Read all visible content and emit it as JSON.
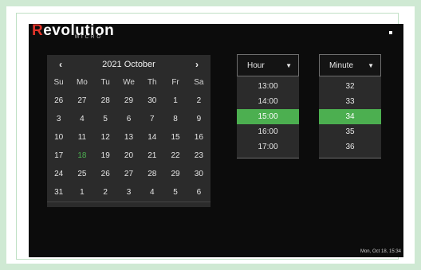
{
  "brand": {
    "logo_first": "R",
    "logo_rest": "evolution",
    "logo_sub": "MICRO"
  },
  "calendar": {
    "year": "2021",
    "month": "October",
    "prev_icon": "‹",
    "next_icon": "›",
    "weekdays": [
      "Su",
      "Mo",
      "Tu",
      "We",
      "Th",
      "Fr",
      "Sa"
    ],
    "weeks": [
      [
        "26",
        "27",
        "28",
        "29",
        "30",
        "1",
        "2"
      ],
      [
        "3",
        "4",
        "5",
        "6",
        "7",
        "8",
        "9"
      ],
      [
        "10",
        "11",
        "12",
        "13",
        "14",
        "15",
        "16"
      ],
      [
        "17",
        "18",
        "19",
        "20",
        "21",
        "22",
        "23"
      ],
      [
        "24",
        "25",
        "26",
        "27",
        "28",
        "29",
        "30"
      ],
      [
        "31",
        "1",
        "2",
        "3",
        "4",
        "5",
        "6"
      ]
    ],
    "today": "18"
  },
  "hour_picker": {
    "label": "Hour",
    "options": [
      "13:00",
      "14:00",
      "15:00",
      "16:00",
      "17:00"
    ],
    "selected": "15:00"
  },
  "minute_picker": {
    "label": "Minute",
    "options": [
      "32",
      "33",
      "34",
      "35",
      "36"
    ],
    "selected": "34"
  },
  "status": {
    "datetime": "Mon, Oct 18, 15:34"
  },
  "colors": {
    "accent": "#4caf50",
    "brand_red": "#e0342a",
    "background": "#0c0c0c"
  }
}
